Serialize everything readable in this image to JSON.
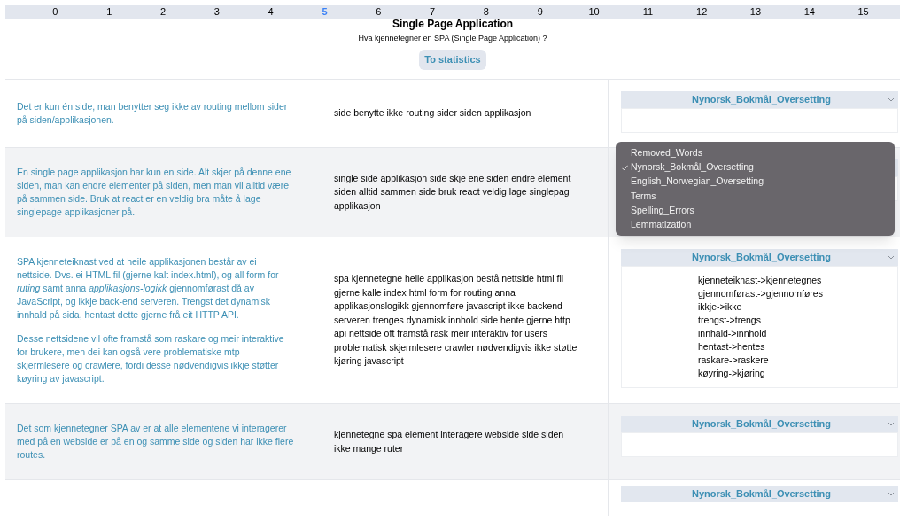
{
  "pager": [
    {
      "label": "0",
      "selected": false
    },
    {
      "label": "1",
      "selected": false
    },
    {
      "label": "2",
      "selected": false
    },
    {
      "label": "3",
      "selected": false
    },
    {
      "label": "4",
      "selected": false
    },
    {
      "label": "5",
      "selected": true
    },
    {
      "label": "6",
      "selected": false
    },
    {
      "label": "7",
      "selected": false
    },
    {
      "label": "8",
      "selected": false
    },
    {
      "label": "9",
      "selected": false
    },
    {
      "label": "10",
      "selected": false
    },
    {
      "label": "11",
      "selected": false
    },
    {
      "label": "12",
      "selected": false
    },
    {
      "label": "13",
      "selected": false
    },
    {
      "label": "14",
      "selected": false
    },
    {
      "label": "15",
      "selected": false
    }
  ],
  "title": "Single Page Application",
  "question": "Hva kjennetegner en SPA (Single Page Application) ?",
  "stats_button": "To statistics",
  "rows": [
    {
      "answer": [
        "Det er kun én side, man benytter seg ikke av routing mellom sider på siden/applikasjonen."
      ],
      "processed": "side benytte ikke routing sider siden applikasjon",
      "select": {
        "value": "Nynorsk_Bokmål_Oversetting",
        "open": false
      },
      "details": []
    },
    {
      "answer": [
        "En single page applikasjon har kun en side. Alt skjer på denne ene siden, man kan endre elementer på siden, men man vil alltid være på sammen side. Bruk at react er en veldig bra måte å lage singlepage applikasjoner på."
      ],
      "processed": "single side applikasjon side skje ene siden endre element siden alltid sammen side bruk react veldig lage singlepag applikasjon",
      "select": {
        "open": true,
        "options": [
          {
            "label": "Removed_Words",
            "selected": false
          },
          {
            "label": "Nynorsk_Bokmål_Oversetting",
            "selected": true
          },
          {
            "label": "English_Norwegian_Oversetting",
            "selected": false
          },
          {
            "label": "Terms",
            "selected": false
          },
          {
            "label": "Spelling_Errors",
            "selected": false
          },
          {
            "label": "Lemmatization",
            "selected": false
          }
        ]
      },
      "details": []
    },
    {
      "answer": [
        "SPA kjenneteiknast ved at heile applikasjonen består av ei nettside. Dvs. ei HTML fil (gjerne kalt index.html), og all form for *ruting* samt anna *applikasjons-logikk* gjennomførast då av JavaScript, og ikkje back-end serveren. Trengst det dynamisk innhald på sida, hentast dette gjerne frå eit HTTP API.",
        "Desse nettsidene vil ofte framstå som raskare og meir interaktive for brukere, men dei kan også vere problematiske mtp skjermlesere og crawlere, fordi desse nødvendigvis ikkje støtter køyring av javascript."
      ],
      "processed": "spa kjennetegne heile applikasjon bestå nettside html fil gjerne kalle index html form for routing anna applikasjonslogikk gjennomføre javascript ikke backend serveren trenges dynamisk innhold side hente gjerne http api nettside oft framstå rask meir interaktiv for users problematisk skjermlesere crawler nødvendigvis ikke støtte kjøring javascript",
      "select": {
        "value": "Nynorsk_Bokmål_Oversetting",
        "open": false
      },
      "details": [
        "kjenneteiknast->kjennetegnes",
        "gjennomførast->gjennomføres",
        "ikkje->ikke",
        "trengst->trengs",
        "innhald->innhold",
        "hentast->hentes",
        "raskare->raskere",
        "køyring->kjøring"
      ]
    },
    {
      "answer": [
        "Det som kjennetegner SPA av er at alle elementene vi interagerer med på en webside er på en og samme side og siden har ikke flere routes."
      ],
      "processed": "kjennetegne spa element interagere webside side siden ikke mange ruter",
      "select": {
        "value": "Nynorsk_Bokmål_Oversetting",
        "open": false
      },
      "details": []
    },
    {
      "select": {
        "value": "Nynorsk_Bokmål_Oversetting",
        "open": false
      }
    }
  ]
}
